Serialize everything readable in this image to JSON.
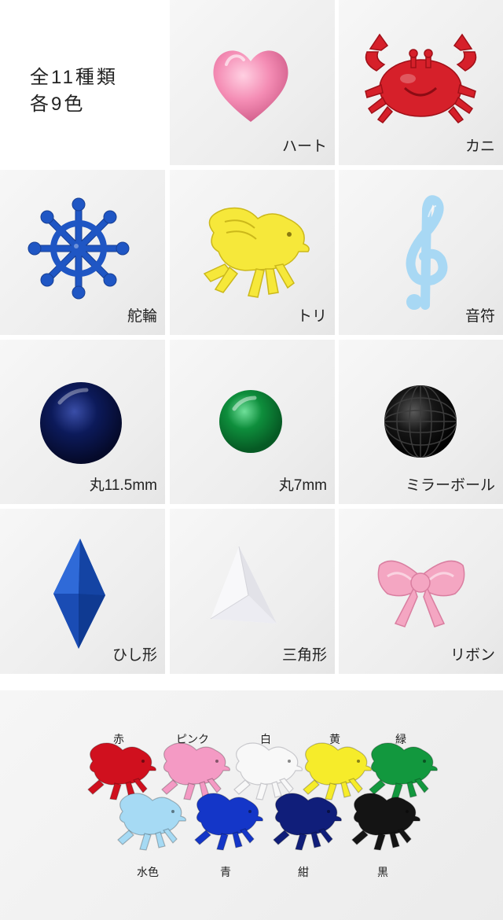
{
  "intro": {
    "line1": "全11種類",
    "line2": "各9色"
  },
  "shapes": [
    {
      "label": "ハート",
      "icon": "heart",
      "color": "#f48cb4"
    },
    {
      "label": "カニ",
      "icon": "crab",
      "color": "#d6202a"
    },
    {
      "label": "舵輪",
      "icon": "ship-wheel",
      "color": "#1f56c4"
    },
    {
      "label": "トリ",
      "icon": "bird",
      "color": "#f6e83a"
    },
    {
      "label": "音符",
      "icon": "treble-clef",
      "color": "#a8d8f4"
    },
    {
      "label": "丸11.5mm",
      "icon": "round-dome",
      "color": "#0c1a5a"
    },
    {
      "label": "丸7mm",
      "icon": "round-dome",
      "color": "#0e8e3c"
    },
    {
      "label": "ミラーボール",
      "icon": "mirror-ball",
      "color": "#111111"
    },
    {
      "label": "ひし形",
      "icon": "diamond",
      "color": "#1c55c2"
    },
    {
      "label": "三角形",
      "icon": "triangle",
      "color": "#f6f6f8"
    },
    {
      "label": "リボン",
      "icon": "ribbon",
      "color": "#f4a6c2"
    }
  ],
  "color_variants": [
    {
      "label": "赤",
      "color": "#d0101e"
    },
    {
      "label": "ピンク",
      "color": "#f49ac4"
    },
    {
      "label": "白",
      "color": "#f8f8f8"
    },
    {
      "label": "黄",
      "color": "#f6ec2a"
    },
    {
      "label": "緑",
      "color": "#12983e"
    },
    {
      "label": "水色",
      "color": "#a6daf4"
    },
    {
      "label": "青",
      "color": "#1436c8"
    },
    {
      "label": "紺",
      "color": "#101e7a"
    },
    {
      "label": "黒",
      "color": "#141414"
    }
  ]
}
